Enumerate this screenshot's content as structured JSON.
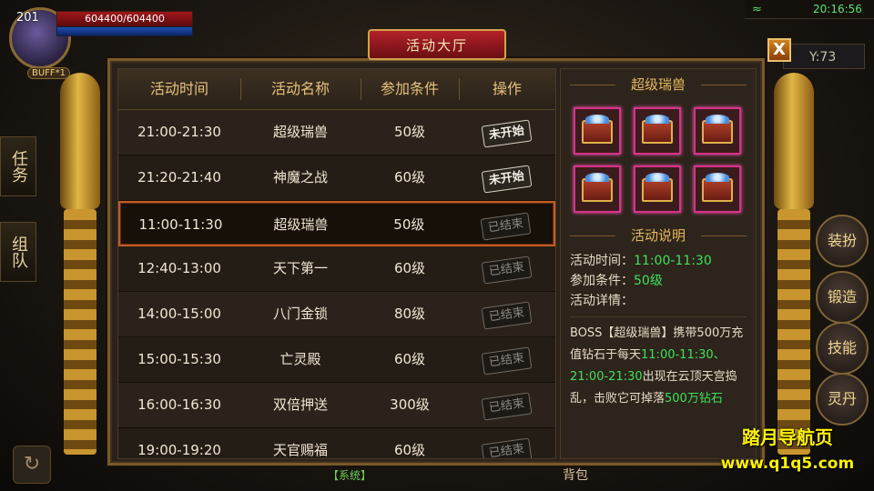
{
  "hud": {
    "level": "201",
    "hp_text": "604400/604400",
    "buff": "BUFF*1",
    "clock": "20:16:56",
    "coord_y": "Y:73",
    "wifi_icon": "wifi-icon"
  },
  "side_tabs": [
    "任务",
    "组队"
  ],
  "right_buttons": [
    "装扮",
    "锻造",
    "技能",
    "灵丹"
  ],
  "dialog": {
    "title": "活动大厅",
    "close_label": "X"
  },
  "table": {
    "headers": [
      "活动时间",
      "活动名称",
      "参加条件",
      "操作"
    ],
    "rows": [
      {
        "time": "21:00-21:30",
        "name": "超级瑞兽",
        "cond": "50级",
        "op": "未开始",
        "state": "pending"
      },
      {
        "time": "21:20-21:40",
        "name": "神魔之战",
        "cond": "60级",
        "op": "未开始",
        "state": "pending"
      },
      {
        "time": "11:00-11:30",
        "name": "超级瑞兽",
        "cond": "50级",
        "op": "已结束",
        "state": "ended",
        "selected": true
      },
      {
        "time": "12:40-13:00",
        "name": "天下第一",
        "cond": "60级",
        "op": "已结束",
        "state": "ended"
      },
      {
        "time": "14:00-15:00",
        "name": "八门金锁",
        "cond": "80级",
        "op": "已结束",
        "state": "ended"
      },
      {
        "time": "15:00-15:30",
        "name": "亡灵殿",
        "cond": "60级",
        "op": "已结束",
        "state": "ended"
      },
      {
        "time": "16:00-16:30",
        "name": "双倍押送",
        "cond": "300级",
        "op": "已结束",
        "state": "ended"
      },
      {
        "time": "19:00-19:20",
        "name": "天官赐福",
        "cond": "60级",
        "op": "已结束",
        "state": "ended"
      }
    ]
  },
  "detail": {
    "reward_title": "超级瑞兽",
    "reward_count": 6,
    "reward_icon": "treasure-chest-icon",
    "desc_title": "活动说明",
    "time_label": "活动时间：",
    "time_value": "11:00-11:30",
    "cond_label": "参加条件：",
    "cond_value": "50级",
    "detail_label": "活动详情：",
    "desc_a": "BOSS【超级瑞兽】携带500万充值钻石于每天",
    "desc_b": "11:00-11:30、21:00-21:30",
    "desc_c": "出现在云顶天宫捣乱，击败它可掉落",
    "desc_d": "500万钻石"
  },
  "bottom": {
    "chat": "【系统】",
    "bag": "背包",
    "refresh_icon": "refresh-icon"
  },
  "promo": {
    "line1": "踏月导航页",
    "line2": "www.q1q5.com"
  },
  "colors": {
    "accent_gold": "#e7c27a",
    "highlight_green": "#3fe05a",
    "selected_border": "#c45a22",
    "title_red": "#b4212a"
  }
}
